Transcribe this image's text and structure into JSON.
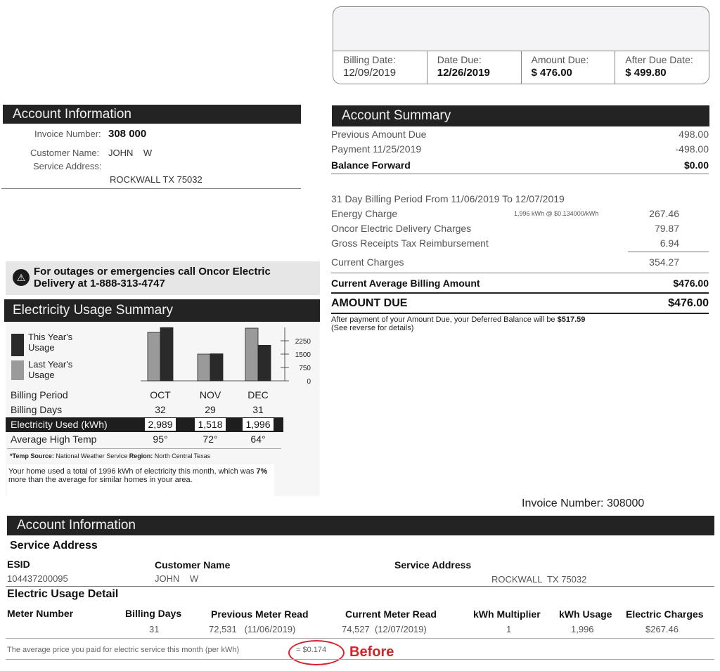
{
  "billing": {
    "cells": [
      {
        "label": "Billing Date:",
        "value": "12/09/2019"
      },
      {
        "label": "Date Due:",
        "value": "12/26/2019"
      },
      {
        "label": "Amount Due:",
        "value": "$ 476.00"
      },
      {
        "label": "After Due Date:",
        "value": "$ 499.80"
      }
    ]
  },
  "account_info": {
    "title": "Account Information",
    "invoice_label": "Invoice Number:",
    "invoice_value": "308 000",
    "customer_label": "Customer Name:",
    "customer_value": "JOHN    W",
    "service_label": "Service Address:",
    "service_value": "ROCKWALL TX 75032"
  },
  "summary": {
    "title": "Account Summary",
    "previous_label": "Previous Amount Due",
    "previous_value": "498.00",
    "payment_label": "Payment  11/25/2019",
    "payment_value": "-498.00",
    "balance_label": "Balance Forward",
    "balance_value": "$0.00",
    "period_label": "31 Day Billing Period From 11/06/2019 To 12/07/2019",
    "energy_label": "Energy Charge",
    "energy_rate": "1,996 kWh @ $0.134000/kWh",
    "energy_value": "267.46",
    "oncor_label": "Oncor Electric Delivery Charges",
    "oncor_value": "79.87",
    "gross_label": "Gross Receipts Tax Reimbursement",
    "gross_value": "6.94",
    "current_label": "Current Charges",
    "current_value": "354.27",
    "avg_label": "Current Average Billing Amount",
    "avg_value": "$476.00",
    "due_label": "AMOUNT DUE",
    "due_value": "$476.00",
    "deferred_text": "After payment of your Amount Due, your Deferred Balance will be",
    "deferred_value": "$517.59",
    "deferred_note": "(See reverse for details)"
  },
  "outage": {
    "line1": "For outages or emergencies call Oncor Electric",
    "line2": "Delivery at 1-888-313-4747"
  },
  "usage": {
    "title": "Electricity Usage Summary",
    "legend_this": "This Year's Usage",
    "legend_last": "Last Year's Usage",
    "period_label": "Billing Period",
    "days_label": "Billing Days",
    "used_label": "Electricity Used (kWh)",
    "temp_label": "Average High Temp",
    "months": [
      "OCT",
      "NOV",
      "DEC"
    ],
    "days": [
      "32",
      "29",
      "31"
    ],
    "used": [
      "2,989",
      "1,518",
      "1,996"
    ],
    "temps": [
      "95°",
      "72°",
      "64°"
    ],
    "source_label": "*Temp Source:",
    "source_value": "National Weather Service",
    "region_label": "Region:",
    "region_value": "North Central Texas",
    "note_a": "Your home used a total of 1996 kWh of electricity this month, which was",
    "note_pct": "7%",
    "note_b": "more than the average for similar homes in your area."
  },
  "chart_data": {
    "type": "bar",
    "categories": [
      "OCT",
      "NOV",
      "DEC"
    ],
    "series": [
      {
        "name": "Last Year's Usage",
        "values": [
          2720,
          1500,
          2960
        ]
      },
      {
        "name": "This Year's Usage",
        "values": [
          2989,
          1518,
          1996
        ]
      }
    ],
    "yticks": [
      "2250",
      "1500",
      "750",
      "0"
    ],
    "ylim": [
      0,
      3000
    ],
    "colors": {
      "this_year": "#2a2a2a",
      "last_year": "#9a9a9a"
    }
  },
  "invoice_number_line": "Invoice Number: 308000",
  "account_detail": {
    "title": "Account Information",
    "service_heading": "Service Address",
    "esid_label": "ESID",
    "esid_value": "104437200095",
    "customer_label": "Customer Name",
    "customer_value": "JOHN    W",
    "address_label": "Service Address",
    "address_value": "ROCKWALL  TX 75032",
    "usage_heading": "Electric Usage Detail",
    "columns": [
      "Meter Number",
      "Billing Days",
      "Previous Meter Read",
      "Current Meter Read",
      "kWh Multiplier",
      "kWh Usage",
      "Electric Charges"
    ],
    "row": [
      "",
      "31",
      "72,531   (11/06/2019)",
      "74,527  (12/07/2019)",
      "1",
      "1,996",
      "$267.46"
    ],
    "avg_text": "The average price you paid for electric service this month (per kWh)",
    "avg_value": "= $0.174",
    "annotation": "Before"
  }
}
